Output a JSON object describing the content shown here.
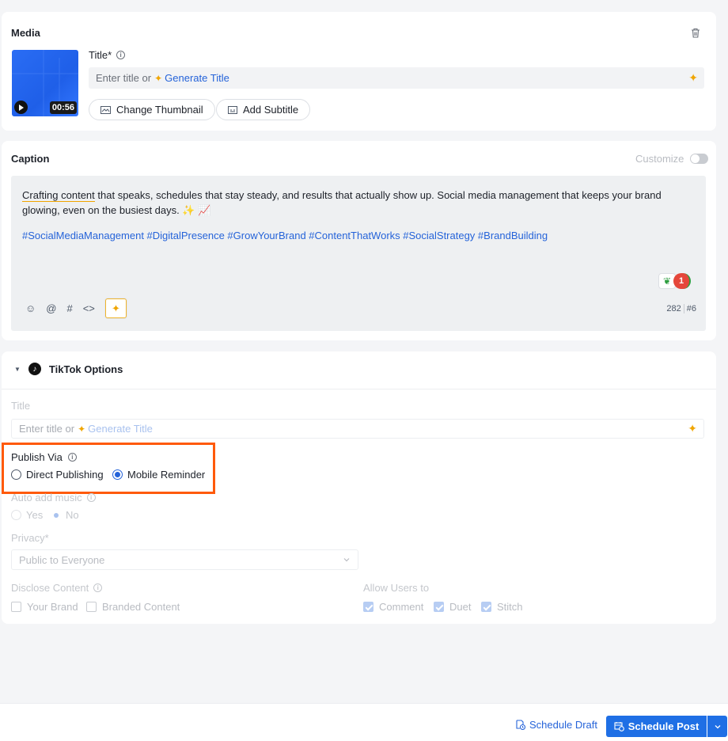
{
  "media": {
    "section_title": "Media",
    "duration": "00:56",
    "title_label": "Title*",
    "title_placeholder": "Enter title or",
    "generate_title": "Generate Title",
    "change_thumbnail": "Change Thumbnail",
    "add_subtitle": "Add Subtitle"
  },
  "caption": {
    "section_title": "Caption",
    "customize_label": "Customize",
    "body_prefix": "Crafting content",
    "body_text": " that speaks, schedules that stay steady, and results that actually show up. Social media management that keeps your brand glowing, even on the busiest days. ✨ 📈",
    "hashtags": "#SocialMediaManagement #DigitalPresence #GrowYourBrand #ContentThatWorks #SocialStrategy #BrandBuilding",
    "issue_count": "1",
    "char_count": "282",
    "hashtag_count": "#6"
  },
  "tiktok": {
    "section_title": "TikTok Options",
    "title_label": "Title",
    "title_placeholder": "Enter title or",
    "generate_title": "Generate Title",
    "publish_via_label": "Publish Via",
    "direct_publishing": "Direct Publishing",
    "mobile_reminder": "Mobile Reminder",
    "publish_via_selected": "Mobile Reminder",
    "auto_music_label": "Auto add music",
    "yes": "Yes",
    "no": "No",
    "privacy_label": "Privacy*",
    "privacy_value": "Public to Everyone",
    "disclose_label": "Disclose Content",
    "your_brand": "Your Brand",
    "branded_content": "Branded Content",
    "allow_label": "Allow Users to",
    "comment": "Comment",
    "duet": "Duet",
    "stitch": "Stitch"
  },
  "footer": {
    "schedule_draft": "Schedule Draft",
    "schedule_post": "Schedule Post"
  },
  "colors": {
    "accent": "#2563d9",
    "highlight_box": "#ff5a0a",
    "primary_button": "#1f6fe5"
  }
}
